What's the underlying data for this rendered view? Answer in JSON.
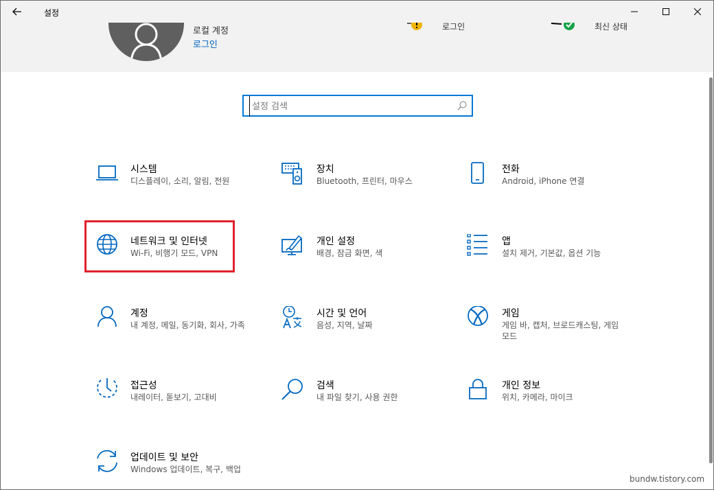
{
  "titlebar": {
    "title": "설정",
    "back_icon": "back-arrow-icon",
    "minimize_icon": "minimize-icon",
    "maximize_icon": "maximize-icon",
    "close_icon": "close-icon"
  },
  "account": {
    "type_label": "로컬 계정",
    "login_link": "로그인",
    "status_items": [
      {
        "label": "로그인",
        "icon": "warning-badge-icon",
        "color": "#f0b400"
      },
      {
        "label": "최신 상태",
        "icon": "check-badge-icon",
        "color": "#16a34a"
      }
    ]
  },
  "search": {
    "placeholder": "설정 검색",
    "icon": "search-icon"
  },
  "accent_color": "#0067c0",
  "highlight_color": "#e0212c",
  "tiles": [
    {
      "label": "시스템",
      "description": "디스플레이, 소리, 알림, 전원",
      "icon": "laptop-icon"
    },
    {
      "label": "장치",
      "description": "Bluetooth, 프린터, 마우스",
      "icon": "keyboard-speaker-icon"
    },
    {
      "label": "전화",
      "description": "Android, iPhone 연결",
      "icon": "phone-icon"
    },
    {
      "label": "네트워크 및 인터넷",
      "description": "Wi-Fi, 비행기 모드, VPN",
      "icon": "globe-icon",
      "highlighted": true
    },
    {
      "label": "개인 설정",
      "description": "배경, 잠금 화면, 색",
      "icon": "paint-monitor-icon"
    },
    {
      "label": "앱",
      "description": "설치 제거, 기본값, 옵션 기능",
      "icon": "app-list-icon"
    },
    {
      "label": "계정",
      "description": "내 계정, 메일, 동기화, 회사, 가족",
      "icon": "person-icon"
    },
    {
      "label": "시간 및 언어",
      "description": "음성, 지역, 날짜",
      "icon": "time-language-icon"
    },
    {
      "label": "게임",
      "description": "게임 바, 캡처, 브로드캐스팅, 게임 모드",
      "icon": "xbox-icon"
    },
    {
      "label": "접근성",
      "description": "내레이터, 돋보기, 고대비",
      "icon": "ease-of-access-icon"
    },
    {
      "label": "검색",
      "description": "내 파일 찾기, 사용 권한",
      "icon": "search-magnifier-icon"
    },
    {
      "label": "개인 정보",
      "description": "위치, 카메라, 마이크",
      "icon": "lock-icon"
    },
    {
      "label": "업데이트 및 보안",
      "description": "Windows 업데이트, 복구, 백업",
      "icon": "update-sync-icon"
    }
  ],
  "watermark": "bundw.tistory.com"
}
